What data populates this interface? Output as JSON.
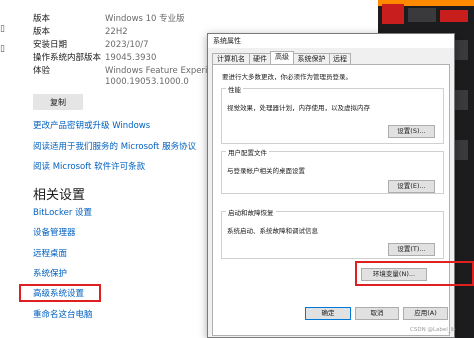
{
  "about": {
    "rows": [
      {
        "key": "版本",
        "value": "Windows 10 专业版"
      },
      {
        "key": "版本",
        "value": "22H2"
      },
      {
        "key": "安装日期",
        "value": "2023/10/7"
      },
      {
        "key": "操作系统内部版本",
        "value": "19045.3930"
      },
      {
        "key": "体验",
        "value": "Windows Feature Experience Pac"
      }
    ],
    "experience_line2": "1000.19053.1000.0",
    "copy_label": "复制",
    "links_top": [
      "更改产品密钥或升级 Windows",
      "阅读适用于我们服务的 Microsoft 服务协议",
      "阅读 Microsoft 软件许可条款"
    ],
    "related_title": "相关设置",
    "related_links": [
      "BitLocker 设置",
      "设备管理器",
      "远程桌面",
      "系统保护",
      "高级系统设置",
      "重命名这台电脑"
    ]
  },
  "dialog": {
    "title": "系统属性",
    "tabs": [
      "计算机名",
      "硬件",
      "高级",
      "系统保护",
      "远程"
    ],
    "admin_note": "要进行大多数更改，你必须作为管理员登录。",
    "groups": {
      "performance": {
        "title": "性能",
        "desc": "视觉效果，处理器计划，内存使用，以及虚拟内存",
        "button": "设置(S)..."
      },
      "profiles": {
        "title": "用户配置文件",
        "desc": "与登录帐户相关的桌面设置",
        "button": "设置(E)..."
      },
      "startup": {
        "title": "启动和故障恢复",
        "desc": "系统启动、系统故障和调试信息",
        "button": "设置(T)..."
      }
    },
    "env_button": "环境变量(N)...",
    "ok": "确定",
    "cancel": "取消",
    "apply": "应用(A)"
  },
  "watermark": "CSDN @Label_lb",
  "colors": {
    "link": "#0060c0",
    "highlight": "#e02020",
    "accent": "#0078d7"
  }
}
